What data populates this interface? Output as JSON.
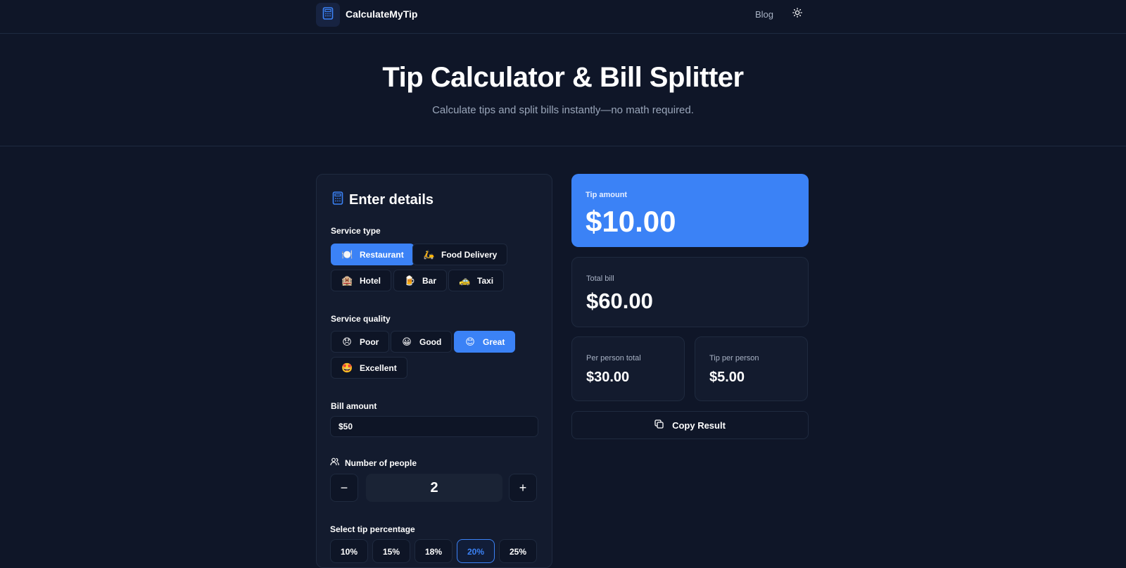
{
  "header": {
    "brand": "CalculateMyTip",
    "nav_blog": "Blog",
    "logo_icon": "calculator-icon",
    "theme_icon": "sun-icon"
  },
  "hero": {
    "title": "Tip Calculator & Bill Splitter",
    "subtitle": "Calculate tips and split bills instantly—no math required."
  },
  "details": {
    "title": "Enter details",
    "service_type_label": "Service type",
    "service_types": [
      {
        "emoji": "🍽️",
        "label": "Restaurant",
        "active": true
      },
      {
        "emoji": "🛵",
        "label": "Food Delivery",
        "active": false
      },
      {
        "emoji": "🏨",
        "label": "Hotel",
        "active": false
      },
      {
        "emoji": "🍺",
        "label": "Bar",
        "active": false
      },
      {
        "emoji": "🚕",
        "label": "Taxi",
        "active": false
      }
    ],
    "service_quality_label": "Service quality",
    "service_qualities": [
      {
        "emoji": "😞",
        "label": "Poor",
        "active": false
      },
      {
        "emoji": "😀",
        "label": "Good",
        "active": false
      },
      {
        "emoji": "😊",
        "label": "Great",
        "active": true
      },
      {
        "emoji": "🤩",
        "label": "Excellent",
        "active": false
      }
    ],
    "bill_amount_label": "Bill amount",
    "bill_amount_value": "$50",
    "people_label": "Number of people",
    "people_count": "2",
    "minus": "−",
    "plus": "+",
    "tip_percentage_label": "Select tip percentage",
    "tip_percentages": [
      {
        "label": "10%",
        "active": false
      },
      {
        "label": "15%",
        "active": false
      },
      {
        "label": "18%",
        "active": false
      },
      {
        "label": "20%",
        "active": true
      },
      {
        "label": "25%",
        "active": false
      }
    ]
  },
  "results": {
    "tip_amount_label": "Tip amount",
    "tip_amount_value": "$10.00",
    "total_bill_label": "Total bill",
    "total_bill_value": "$60.00",
    "per_person_total_label": "Per person total",
    "per_person_total_value": "$30.00",
    "tip_per_person_label": "Tip per person",
    "tip_per_person_value": "$5.00",
    "copy_label": "Copy Result"
  },
  "colors": {
    "background": "#0f1628",
    "card": "#131b2e",
    "accent": "#3b82f6"
  }
}
